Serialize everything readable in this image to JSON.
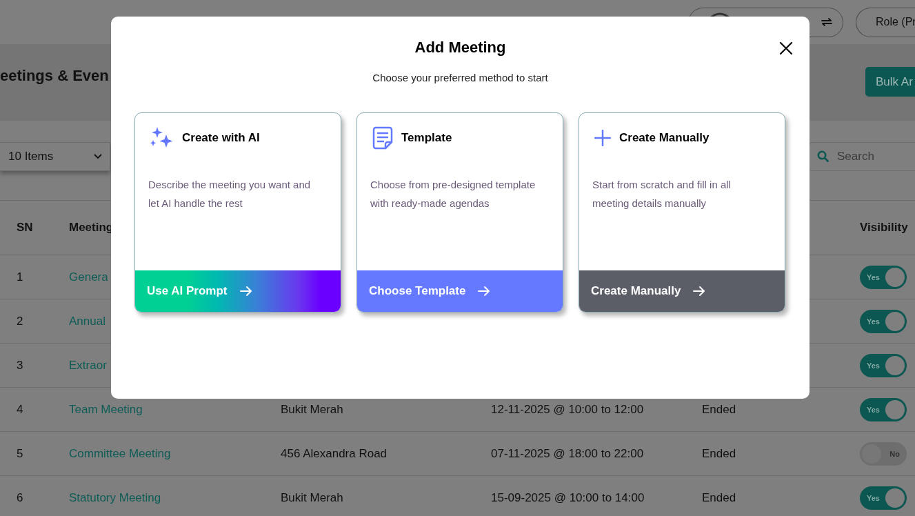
{
  "topbar": {
    "role_button": "Role (Pr"
  },
  "page": {
    "title": "eetings & Even",
    "bulk_button": "Bulk Ar",
    "page_size": "10 Items",
    "search": {
      "placeholder": "Search"
    }
  },
  "table": {
    "columns": [
      "SN",
      "Meeting",
      "Visibility"
    ],
    "rows": [
      {
        "sn": "1",
        "meeting": "Genera",
        "visible": true,
        "visibility_label": "Yes"
      },
      {
        "sn": "2",
        "meeting": "Annual",
        "visible": true,
        "visibility_label": "Yes"
      },
      {
        "sn": "3",
        "meeting": "Extraor",
        "visible": true,
        "visibility_label": "Yes"
      },
      {
        "sn": "4",
        "meeting": "Team Meeting",
        "venue": "Bukit Merah",
        "datetime": "12-11-2025 @ 10:00 to 12:00",
        "status": "Ended",
        "visible": true,
        "visibility_label": "Yes"
      },
      {
        "sn": "5",
        "meeting": "Committee Meeting",
        "venue": "456 Alexandra Road",
        "datetime": "07-11-2025 @ 18:00 to 22:00",
        "status": "Ended",
        "visible": false,
        "visibility_label": "No"
      },
      {
        "sn": "6",
        "meeting": "Statutory Meeting",
        "venue": "Bukit Merah",
        "datetime": "15-09-2025 @ 10:00 to 14:00",
        "status": "Ended",
        "visible": true,
        "visibility_label": "Yes"
      }
    ]
  },
  "modal": {
    "title": "Add Meeting",
    "subtitle": "Choose your preferred method to start",
    "cards": [
      {
        "kind": "ai",
        "title": "Create with AI",
        "description": "Describe the meeting you want and let AI handle the rest",
        "action": "Use AI Prompt"
      },
      {
        "kind": "template",
        "title": "Template",
        "description": "Choose from pre-designed template with ready-made agendas",
        "action": "Choose Template"
      },
      {
        "kind": "manual",
        "title": "Create Manually",
        "description": "Start from scratch and fill in all meeting details manually",
        "action": "Create Manually"
      }
    ]
  }
}
